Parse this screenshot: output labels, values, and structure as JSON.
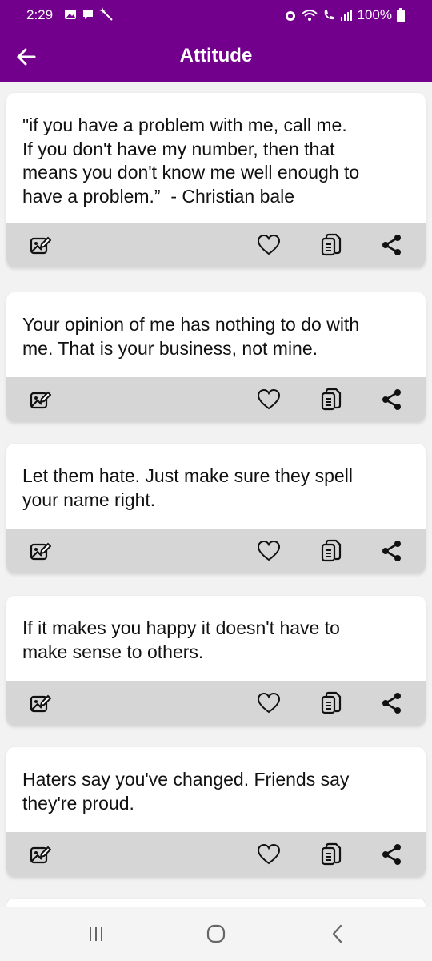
{
  "status": {
    "time": "2:29",
    "battery": "100%"
  },
  "header": {
    "title": "Attitude"
  },
  "quotes": [
    {
      "text": "\"if you have a problem with me, call me.\nIf you don't have my number, then that\nmeans you don't know me well enough to\nhave a problem.”  - Christian bale"
    },
    {
      "text": "Your opinion of me has nothing to do with\nme. That is your business, not mine."
    },
    {
      "text": "Let them hate. Just make sure they spell\nyour name right."
    },
    {
      "text": "If it makes you happy it doesn't have to\nmake sense to others."
    },
    {
      "text": "Haters say you've changed. Friends say\nthey're proud."
    }
  ],
  "colors": {
    "primary": "#72008c",
    "action_bar": "#d6d6d6"
  },
  "icons": {
    "back": "arrow-left-icon",
    "edit": "image-edit-icon",
    "favorite": "heart-icon",
    "copy": "copy-icon",
    "share": "share-icon"
  }
}
